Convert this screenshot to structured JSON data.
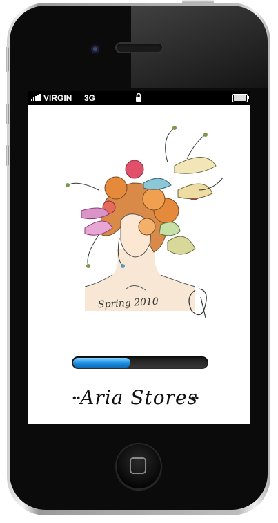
{
  "status_bar": {
    "carrier": "VIRGIN",
    "network": "3G",
    "signal_icon": "signal-bars-icon",
    "lock_icon": "lock-icon",
    "battery_icon": "battery-icon"
  },
  "splash": {
    "brand": "Aria Stores",
    "brand_dots_left": "••",
    "brand_dots_right": "••",
    "progress": 0.43
  },
  "artwork": {
    "caption": "Spring 2010"
  },
  "colors": {
    "progress_fill": "#1c8ee0",
    "progress_track": "#2a2a2a",
    "phone_body": "#0b0b0b"
  }
}
